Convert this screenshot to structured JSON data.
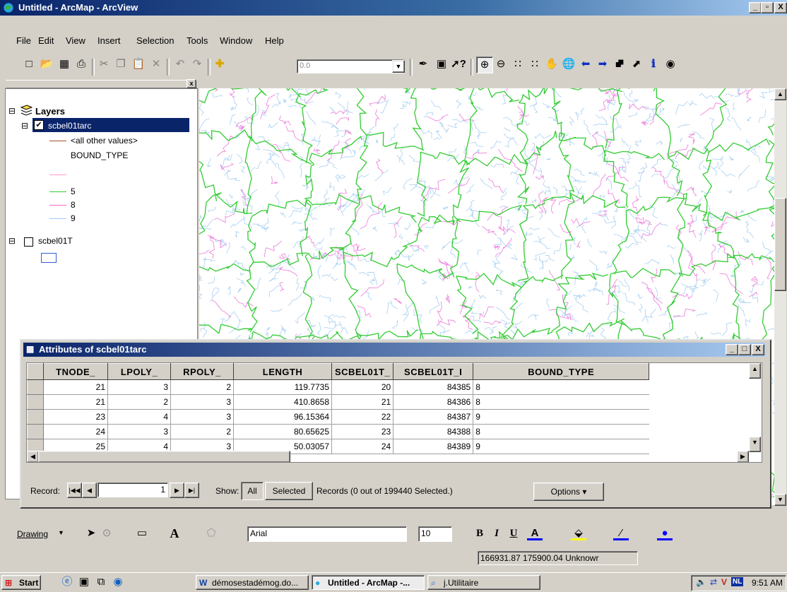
{
  "window": {
    "title": "Untitled - ArcMap - ArcView",
    "controls": [
      "_",
      "▫",
      "X"
    ]
  },
  "menu": [
    "File",
    "Edit",
    "View",
    "Insert",
    "Selection",
    "Tools",
    "Window",
    "Help"
  ],
  "toolbar": {
    "scale_value": "0.0"
  },
  "toc": {
    "root_label": "Layers",
    "layers": [
      {
        "name": "scbel01tarc",
        "checked": true,
        "legend_other": "<all other values>",
        "field_label": "BOUND_TYPE",
        "classes": [
          {
            "label": "",
            "color": "#ff99cc"
          },
          {
            "label": "5",
            "color": "#33cc33"
          },
          {
            "label": "8",
            "color": "#ff66cc"
          },
          {
            "label": "9",
            "color": "#99ccff"
          }
        ]
      },
      {
        "name": "scbel01T",
        "checked": false
      }
    ]
  },
  "colors": {
    "boundary_5": "#33cc33",
    "boundary_8": "#ee88dd",
    "boundary_9": "#a8cff0",
    "selection": "#0a246a"
  },
  "attributes": {
    "title": "Attributes of scbel01tarc",
    "columns": [
      "TNODE_",
      "LPOLY_",
      "RPOLY_",
      "LENGTH",
      "SCBEL01T_",
      "SCBEL01T_I",
      "BOUND_TYPE"
    ],
    "rows": [
      [
        "21",
        "3",
        "2",
        "119.7735",
        "20",
        "84385",
        "8"
      ],
      [
        "21",
        "2",
        "3",
        "410.8658",
        "21",
        "84386",
        "8"
      ],
      [
        "23",
        "4",
        "3",
        "96.15364",
        "22",
        "84387",
        "9"
      ],
      [
        "24",
        "3",
        "2",
        "80.65625",
        "23",
        "84388",
        "8"
      ],
      [
        "25",
        "4",
        "3",
        "50.03057",
        "24",
        "84389",
        "9"
      ]
    ],
    "record_label": "Record:",
    "record_value": "1",
    "show_label": "Show:",
    "all_button": "All",
    "selected_button": "Selected",
    "records_status": "Records (0 out of 199440 Selected.)",
    "options_button": "Options"
  },
  "drawing": {
    "drawing_label": "Drawing",
    "font_name": "Arial",
    "font_size": "10",
    "bold": "B",
    "italic": "I",
    "underline": "U"
  },
  "status": {
    "coordinates": "166931.87  175900.04 Unknowr"
  },
  "taskbar": {
    "start": "Start",
    "tasks": [
      "démosestadémog.do...",
      "Untitled - ArcMap -...",
      "j.Utilitaire"
    ],
    "tray_lang": "NL",
    "clock": "9:51 AM"
  }
}
